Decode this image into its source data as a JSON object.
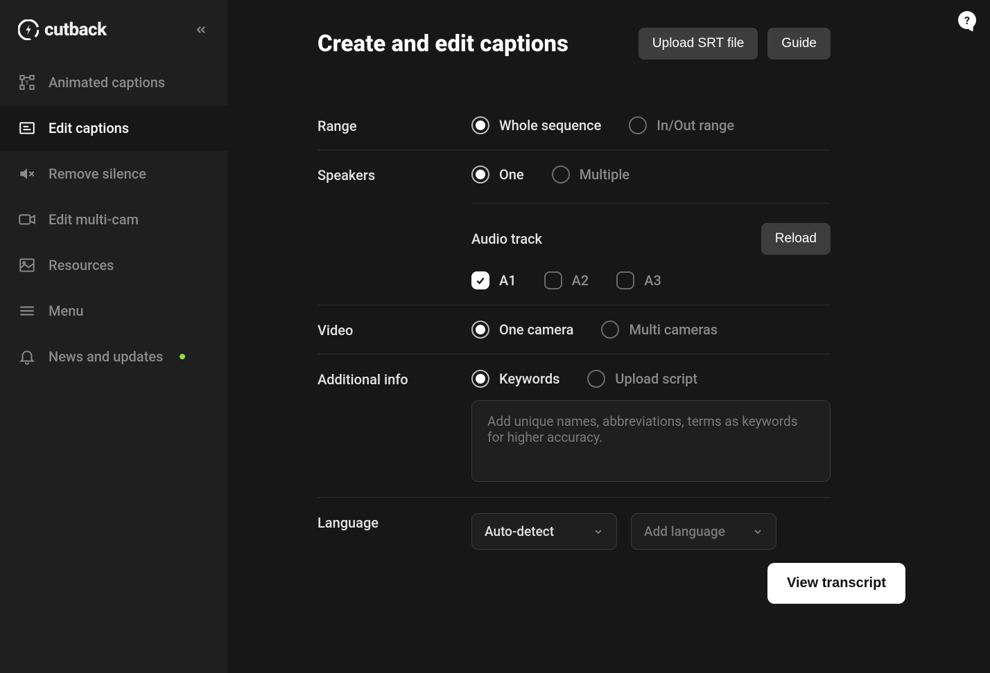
{
  "logo": {
    "text": "cutback"
  },
  "sidebar": {
    "items": [
      {
        "label": "Animated captions"
      },
      {
        "label": "Edit captions"
      },
      {
        "label": "Remove silence"
      },
      {
        "label": "Edit multi-cam"
      },
      {
        "label": "Resources"
      },
      {
        "label": "Menu"
      },
      {
        "label": "News and updates"
      }
    ]
  },
  "header": {
    "title": "Create and edit captions",
    "upload_label": "Upload SRT file",
    "guide_label": "Guide"
  },
  "form": {
    "range": {
      "label": "Range",
      "whole": "Whole sequence",
      "inout": "In/Out range"
    },
    "speakers": {
      "label": "Speakers",
      "one": "One",
      "multiple": "Multiple"
    },
    "audio": {
      "label": "Audio track",
      "reload": "Reload",
      "tracks": [
        "A1",
        "A2",
        "A3"
      ]
    },
    "video": {
      "label": "Video",
      "one": "One camera",
      "multi": "Multi cameras"
    },
    "additional": {
      "label": "Additional info",
      "keywords": "Keywords",
      "upload_script": "Upload script",
      "placeholder": "Add unique names, abbreviations, terms as keywords for higher accuracy."
    },
    "language": {
      "label": "Language",
      "auto": "Auto-detect",
      "add": "Add language"
    }
  },
  "actions": {
    "view_transcript": "View transcript"
  },
  "help": "?"
}
